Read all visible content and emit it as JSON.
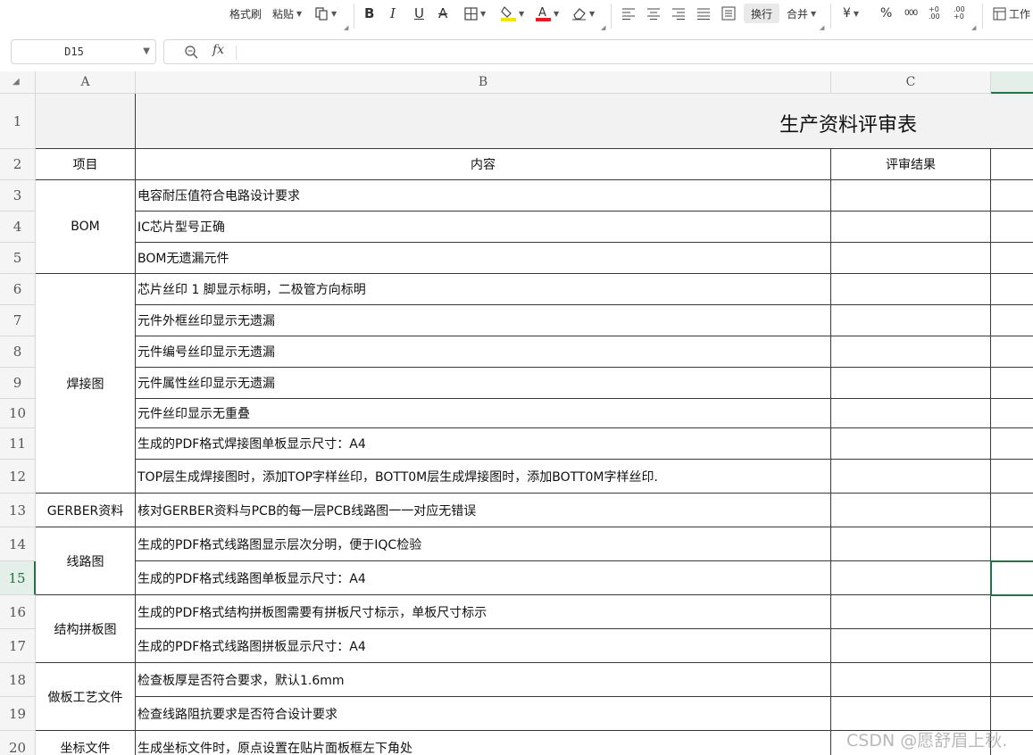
{
  "toolbar": {
    "format_painter": "格式刷",
    "paste": "粘贴",
    "wrap_text": "换行",
    "merge": "合并",
    "currency": "¥",
    "percent": "%",
    "thousands": "000",
    "dec_inc": "+0 .00",
    "dec_dec": ".00 +0",
    "worksheet": "工作"
  },
  "formula_bar": {
    "name_box": "D15",
    "fx": "fx",
    "formula": ""
  },
  "columns": [
    "A",
    "B",
    "C"
  ],
  "rows": [
    "1",
    "2",
    "3",
    "4",
    "5",
    "6",
    "7",
    "8",
    "9",
    "10",
    "11",
    "12",
    "13",
    "14",
    "15",
    "16",
    "17",
    "18",
    "19",
    "20"
  ],
  "sheet": {
    "title": "生产资料评审表",
    "headers": {
      "item": "项目",
      "content": "内容",
      "result": "评审结果"
    },
    "groups": [
      {
        "name": "BOM"
      },
      {
        "name": "焊接图"
      },
      {
        "name": "GERBER资料"
      },
      {
        "name": "线路图"
      },
      {
        "name": "结构拼板图"
      },
      {
        "name": "做板工艺文件"
      },
      {
        "name": "坐标文件"
      }
    ],
    "items": [
      "电容耐压值符合电路设计要求",
      "IC芯片型号正确",
      "BOM无遗漏元件",
      "芯片丝印 1 脚显示标明，二极管方向标明",
      "元件外框丝印显示无遗漏",
      "元件编号丝印显示无遗漏",
      "元件属性丝印显示无遗漏",
      "元件丝印显示无重叠",
      "生成的PDF格式焊接图单板显示尺寸：A4",
      "TOP层生成焊接图时，添加TOP字样丝印，BOTT0M层生成焊接图时，添加BOTT0M字样丝印.",
      "核对GERBER资料与PCB的每一层PCB线路图一一对应无错误",
      "生成的PDF格式线路图显示层次分明，便于IQC检验",
      "生成的PDF格式线路图单板显示尺寸：A4",
      "生成的PDF格式结构拼板图需要有拼板尺寸标示，单板尺寸标示",
      "生成的PDF格式线路图拼板显示尺寸：A4",
      "检查板厚是否符合要求，默认1.6mm",
      "检查线路阻抗要求是否符合设计要求",
      "生成坐标文件时，原点设置在贴片面板框左下角处"
    ]
  },
  "watermark": "CSDN @愿舒眉上秋.",
  "colors": {
    "accent": "#217346",
    "border": "#3a3a3a",
    "font_red": "#e02020",
    "highlight_yellow": "#f5e400"
  }
}
